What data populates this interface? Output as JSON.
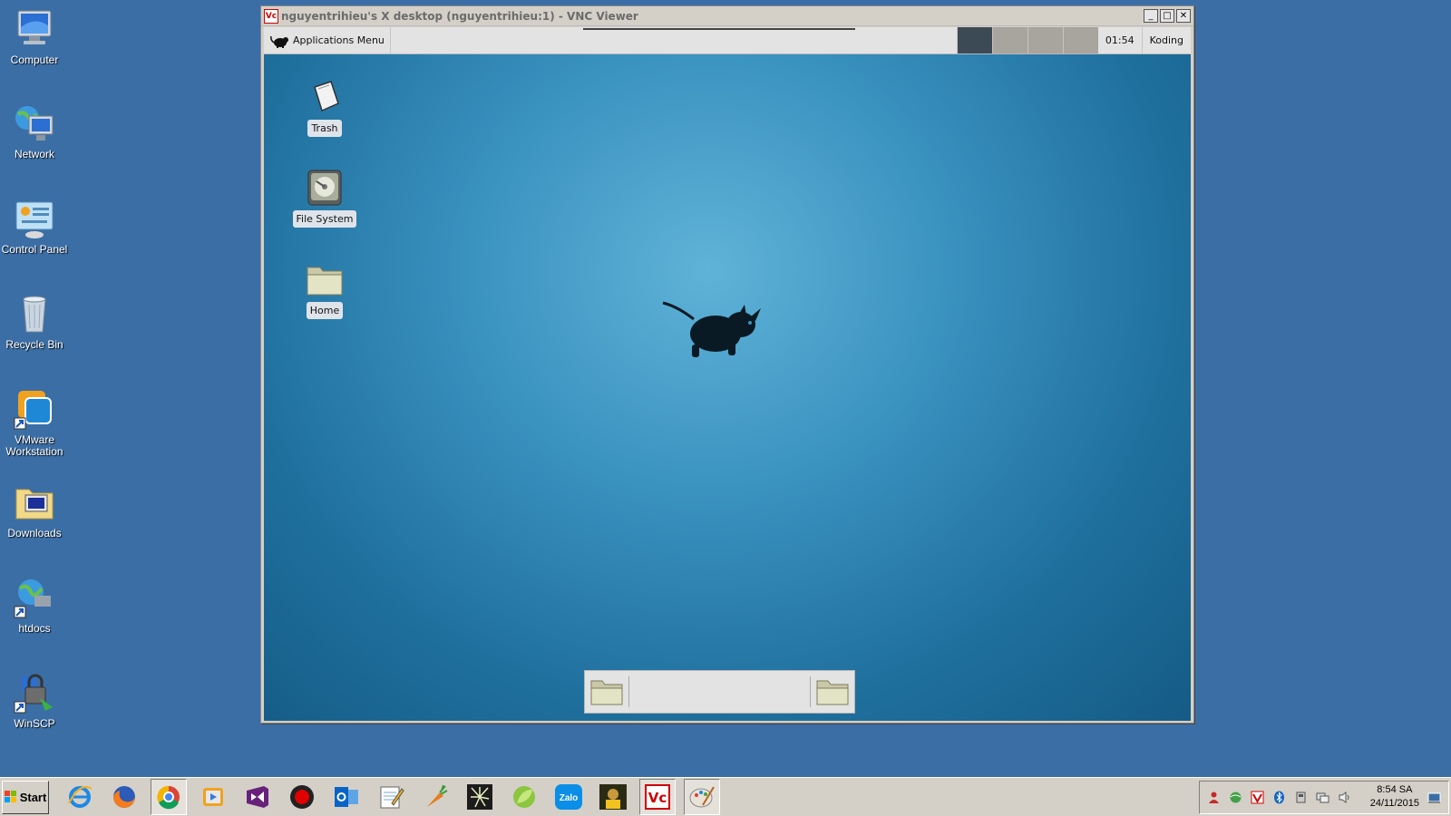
{
  "desktop_icons": [
    {
      "label": "Computer",
      "icon": "computer-icon"
    },
    {
      "label": "Network",
      "icon": "network-icon"
    },
    {
      "label": "Control Panel",
      "icon": "control-panel-icon"
    },
    {
      "label": "Recycle Bin",
      "icon": "recycle-bin-icon"
    },
    {
      "label": "VMware Workstation",
      "icon": "vmware-icon"
    },
    {
      "label": "Downloads",
      "icon": "downloads-folder-icon"
    },
    {
      "label": "htdocs",
      "icon": "htdocs-shortcut-icon"
    },
    {
      "label": "WinSCP",
      "icon": "winscp-icon"
    }
  ],
  "vnc_window": {
    "app_icon_text": "Vc",
    "title": "nguyentrihieu's X desktop (nguyentrihieu:1) - VNC Viewer",
    "controls": {
      "minimize": "_",
      "maximize": "□",
      "close": "✕"
    }
  },
  "remote": {
    "panel": {
      "app_menu_label": "Applications Menu",
      "clock": "01:54",
      "user": "Koding",
      "workspaces": 4,
      "active_workspace": 1
    },
    "desktop_icons": [
      {
        "label": "Trash"
      },
      {
        "label": "File System"
      },
      {
        "label": "Home"
      }
    ]
  },
  "taskbar": {
    "start_label": "Start",
    "quick_launch": [
      "internet-explorer-icon",
      "firefox-icon",
      "chrome-icon",
      "media-player-icon",
      "visual-studio-icon",
      "record-icon",
      "outlook-icon",
      "notepad-icon",
      "carrot-tool-icon",
      "firework-icon",
      "leaf-app-icon",
      "zalo-icon",
      "game-icon",
      "vnc-viewer-icon",
      "paint-icon"
    ],
    "zalo_text": "Zalo",
    "vnc_text": "Vc",
    "tray": {
      "time": "8:54 SA",
      "date": "24/11/2015"
    }
  }
}
